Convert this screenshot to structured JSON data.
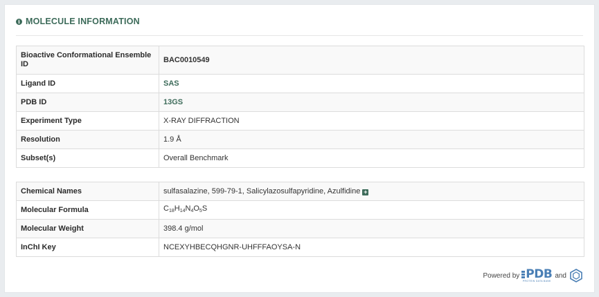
{
  "panel": {
    "title": "MOLECULE INFORMATION",
    "title_icon": "info-circle-icon"
  },
  "identity_table": [
    {
      "label": "Bioactive Conformational Ensemble ID",
      "value": "BAC0010549",
      "style": "bold"
    },
    {
      "label": "Ligand ID",
      "value": "SAS",
      "style": "link"
    },
    {
      "label": "PDB ID",
      "value": "13GS",
      "style": "link"
    },
    {
      "label": "Experiment Type",
      "value": "X-RAY DIFFRACTION",
      "style": "plain"
    },
    {
      "label": "Resolution",
      "value": "1.9 Å",
      "style": "plain"
    },
    {
      "label": "Subset(s)",
      "value": "Overall Benchmark",
      "style": "plain"
    }
  ],
  "chemical_table": [
    {
      "label": "Chemical Names",
      "value": "sulfasalazine, 599-79-1, Salicylazosulfapyridine, Azulfidine",
      "expand_icon": "plus-square-icon"
    },
    {
      "label": "Molecular Formula",
      "formula": {
        "C": "18",
        "H": "14",
        "N": "4",
        "O": "5",
        "S": ""
      }
    },
    {
      "label": "Molecular Weight",
      "value": "398.4 g/mol"
    },
    {
      "label": "InChI Key",
      "value": "NCEXYHBECQHGNR-UHFFFAOYSA-N"
    }
  ],
  "footer": {
    "powered_by": "Powered by",
    "pdb_logo_text": "PDB",
    "pdb_logo_subtext": "PROTEIN DATA BANK",
    "and": "and",
    "second_logo": "hexagon-logo-icon"
  },
  "colors": {
    "accent": "#3d6b5a",
    "pdb_blue": "#4a7fb5",
    "page_bg": "#e9ecef"
  }
}
